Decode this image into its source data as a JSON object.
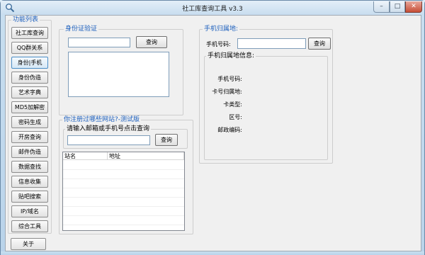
{
  "window": {
    "title": "社工库查询工具 v3.3"
  },
  "sidebar": {
    "legend": "功能列表",
    "items": [
      {
        "label": "社工库查询"
      },
      {
        "label": "QQ群关系"
      },
      {
        "label": "身份|手机"
      },
      {
        "label": "身份伪造"
      },
      {
        "label": "艺术字典"
      },
      {
        "label": "MD5加解密"
      },
      {
        "label": "密码生成"
      },
      {
        "label": "开房查询"
      },
      {
        "label": "邮件伪造"
      },
      {
        "label": "数据查找"
      },
      {
        "label": "信息收集"
      },
      {
        "label": "贴吧搜索"
      },
      {
        "label": "IP/域名"
      },
      {
        "label": "综合工具"
      }
    ],
    "about_label": "关于"
  },
  "id_verify": {
    "legend": "身份证验证",
    "input_value": "",
    "query_label": "查询",
    "result_text": ""
  },
  "site_check": {
    "legend": "你注册过哪些网站?-测试版",
    "inner_legend": "请输入邮箱或手机号点击查询",
    "input_value": "",
    "query_label": "查询",
    "columns": [
      "站名",
      "地址"
    ],
    "rows": []
  },
  "phone_location": {
    "legend": "手机归属地:",
    "phone_label": "手机号码:",
    "phone_value": "",
    "query_label": "查询",
    "info_legend": "手机归属地信息:",
    "fields": [
      {
        "label": "手机号码:",
        "value": ""
      },
      {
        "label": "卡号归属地:",
        "value": ""
      },
      {
        "label": "卡类型:",
        "value": ""
      },
      {
        "label": "区号:",
        "value": ""
      },
      {
        "label": "邮政编码:",
        "value": ""
      }
    ]
  },
  "colors": {
    "legend_text": "#1c5fbd",
    "window_frame": "#b9d3ea",
    "close_button": "#c64d35"
  }
}
